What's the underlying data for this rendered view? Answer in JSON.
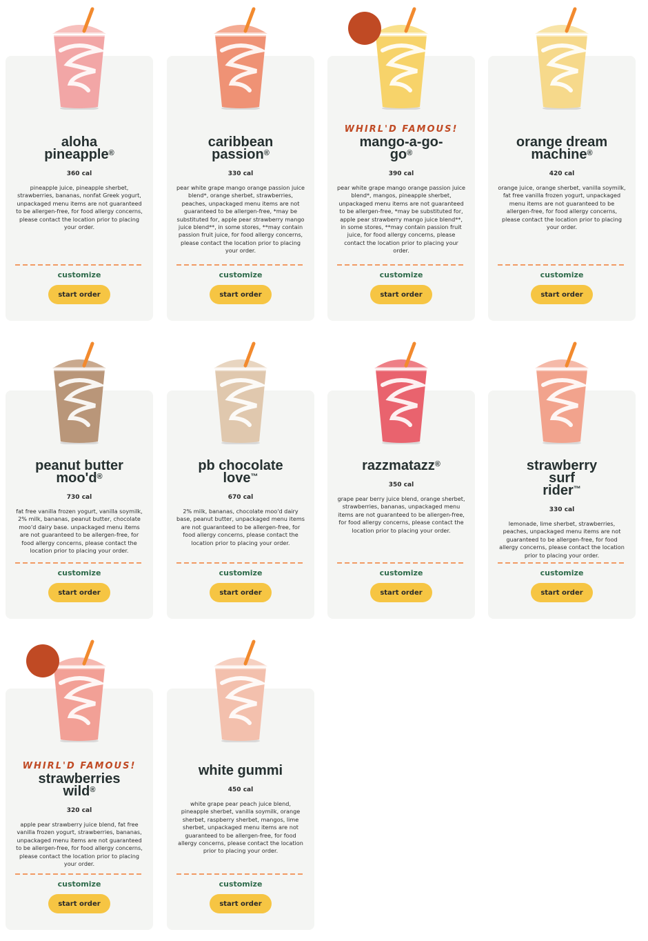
{
  "colors": {
    "card_bg": "#f4f5f3",
    "accent_orange": "#f19a63",
    "famous_red": "#c04a24",
    "customize_green": "#2e6a4a",
    "button_yellow": "#f6c543"
  },
  "products": [
    {
      "name": "aloha pineapple",
      "mark": "®",
      "famous": "",
      "calories": "360 cal",
      "ingredients": "pineapple juice, pineapple sherbet, strawberries, bananas, nonfat Greek yogurt, unpackaged menu items are not guaranteed to be allergen-free, for food allergy concerns, please contact the location prior to placing your order.",
      "customize": "customize",
      "start_order": "start order",
      "cup_color": "#f2a6a6",
      "top_color": "#f7c0bd"
    },
    {
      "name": "caribbean passion",
      "mark": "®",
      "famous": "",
      "calories": "330 cal",
      "ingredients": "pear white grape mango orange passion juice blend*, orange sherbet, strawberries, peaches, unpackaged menu items are not guaranteed to be allergen-free, *may be substituted for, apple pear strawberry mango juice blend**, in some stores, **may contain passion fruit juice, for food allergy concerns, please contact the location prior to placing your order.",
      "customize": "customize",
      "start_order": "start order",
      "cup_color": "#ef9275",
      "top_color": "#f4ab93"
    },
    {
      "name": "mango-a-go-go",
      "mark": "®",
      "famous": "WHIRL'D FAMOUS!",
      "calories": "390 cal",
      "ingredients": "pear white grape mango orange passion juice blend*, mangos, pineapple sherbet, unpackaged menu items are not guaranteed to be allergen-free, *may be substituted for, apple pear strawberry mango juice blend**, in some stores, **may contain passion fruit juice, for food allergy concerns, please contact the location prior to placing your order.",
      "customize": "customize",
      "start_order": "start order",
      "cup_color": "#f7d36a",
      "top_color": "#f9e08b"
    },
    {
      "name": "orange dream machine",
      "mark": "®",
      "famous": "",
      "calories": "420 cal",
      "ingredients": "orange juice, orange sherbet, vanilla soymilk, fat free vanilla frozen yogurt, unpackaged menu items are not guaranteed to be allergen-free, for food allergy concerns, please contact the location prior to placing your order.",
      "customize": "customize",
      "start_order": "start order",
      "cup_color": "#f6d98b",
      "top_color": "#f8e4a8"
    },
    {
      "name": "peanut butter moo'd",
      "mark": "®",
      "famous": "",
      "calories": "730 cal",
      "ingredients": "fat free vanilla frozen yogurt, vanilla soymilk, 2% milk, bananas, peanut butter, chocolate moo'd dairy base. unpackaged menu items are not guaranteed to be allergen-free, for food allergy concerns, please contact the location prior to placing your order.",
      "customize": "customize",
      "start_order": "start order",
      "cup_color": "#b99679",
      "top_color": "#c9a98e"
    },
    {
      "name": "pb chocolate love",
      "mark": "™",
      "famous": "",
      "calories": "670 cal",
      "ingredients": "2% milk, bananas, chocolate moo'd dairy base, peanut butter, unpackaged menu items are not guaranteed to be allergen-free, for food allergy concerns, please contact the location prior to placing your order.",
      "customize": "customize",
      "start_order": "start order",
      "cup_color": "#e0c8ae",
      "top_color": "#e8d5c0"
    },
    {
      "name": "razzmatazz",
      "mark": "®",
      "famous": "",
      "calories": "350 cal",
      "ingredients": "grape pear berry juice blend, orange sherbet, strawberries, bananas, unpackaged menu items are not guaranteed to be allergen-free, for food allergy concerns, please contact the location prior to placing your order.",
      "customize": "customize",
      "start_order": "start order",
      "cup_color": "#e9636e",
      "top_color": "#ee7f86"
    },
    {
      "name": "strawberry surf rider",
      "mark": "™",
      "famous": "",
      "calories": "330 cal",
      "ingredients": "lemonade, lime sherbet, strawberries, peaches, unpackaged menu items are not guaranteed to be allergen-free, for food allergy concerns, please contact the location prior to placing your order.",
      "customize": "customize",
      "start_order": "start order",
      "cup_color": "#f2a38d",
      "top_color": "#f5b9a8"
    },
    {
      "name": "strawberries wild",
      "mark": "®",
      "famous": "WHIRL'D FAMOUS!",
      "calories": "320 cal",
      "ingredients": "apple pear strawberry juice blend, fat free vanilla frozen yogurt, strawberries, bananas, unpackaged menu items are not guaranteed to be allergen-free, for food allergy concerns, please contact the location prior to placing your order.",
      "customize": "customize",
      "start_order": "start order",
      "cup_color": "#f2a096",
      "top_color": "#f6b8b0"
    },
    {
      "name": "white gummi",
      "mark": "",
      "famous": "",
      "calories": "450 cal",
      "ingredients": "white grape pear peach juice blend, pineapple sherbet, vanilla soymilk, orange sherbet, raspberry sherbet, mangos, lime sherbet, unpackaged menu items are not guaranteed to be allergen-free, for food allergy concerns, please contact the location prior to placing your order.",
      "customize": "customize",
      "start_order": "start order",
      "cup_color": "#f3c0ad",
      "top_color": "#f6d0c1"
    }
  ]
}
